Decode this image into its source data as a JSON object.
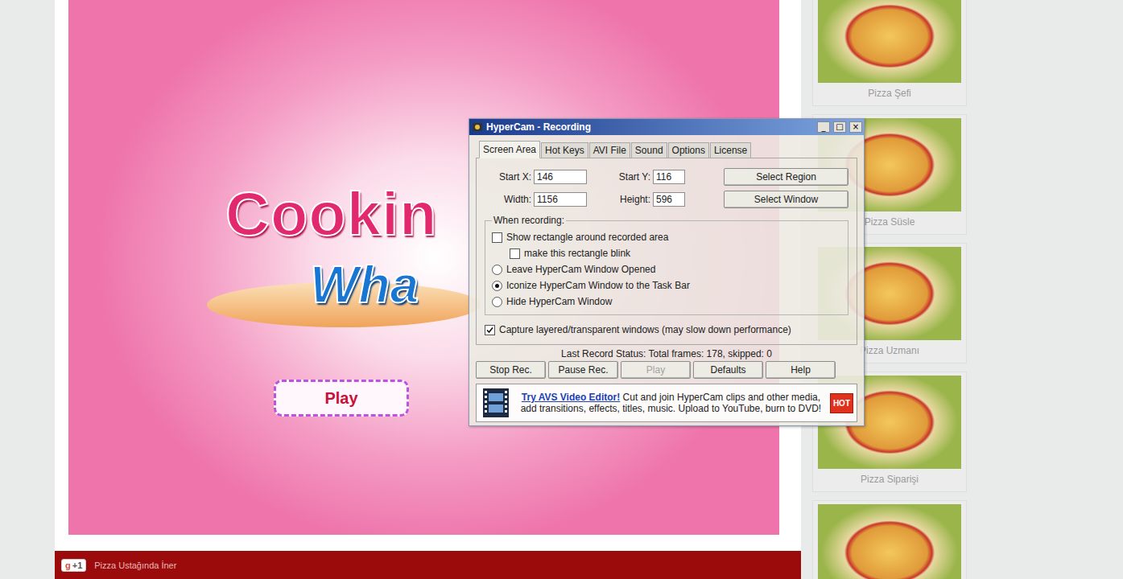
{
  "page": {
    "footer": {
      "plus_one": "+1",
      "text": "Pizza Ustağında İner"
    }
  },
  "game": {
    "logo_top": "Cookin",
    "logo_bottom": "Wha",
    "play": "Play"
  },
  "sidebar": {
    "items": [
      {
        "caption": "Pizza Şefi"
      },
      {
        "caption": "Pizza Süsle"
      },
      {
        "caption": "Pizza Uzmanı"
      },
      {
        "caption": "Pizza Siparişi"
      },
      {}
    ]
  },
  "hypercam": {
    "title": "HyperCam - Recording",
    "title_buttons": [
      "_",
      "□",
      "×"
    ],
    "tabs": [
      {
        "label": "Screen Area",
        "selected": true
      },
      {
        "label": "Hot Keys",
        "selected": false
      },
      {
        "label": "AVI File",
        "selected": false
      },
      {
        "label": "Sound",
        "selected": false
      },
      {
        "label": "Options",
        "selected": false
      },
      {
        "label": "License",
        "selected": false
      }
    ],
    "fields": [
      {
        "label": "Start X:",
        "value": "146"
      },
      {
        "label": "Start Y:",
        "value": "116"
      },
      {
        "label": "Width:",
        "value": "1156"
      },
      {
        "label": "Height:",
        "value": "596"
      }
    ],
    "region_buttons": [
      "Select Region",
      "Select Window"
    ],
    "group_label": "When recording:",
    "options": [
      {
        "kind": "checkbox",
        "label": "Show rectangle around recorded area",
        "checked": false,
        "indent": false
      },
      {
        "kind": "checkbox",
        "label": "make this rectangle blink",
        "checked": false,
        "indent": true
      },
      {
        "kind": "radio",
        "label": "Leave HyperCam Window Opened",
        "selected": false,
        "indent": false
      },
      {
        "kind": "radio",
        "label": "Iconize HyperCam Window to the Task Bar",
        "selected": true,
        "indent": false
      },
      {
        "kind": "radio",
        "label": "Hide HyperCam Window",
        "selected": false,
        "indent": false
      }
    ],
    "capture": {
      "label": "Capture layered/transparent windows (may slow down performance)",
      "checked": true
    },
    "status": "Last Record Status: Total frames: 178, skipped: 0",
    "buttons": [
      {
        "label": "Stop Rec.",
        "disabled": false
      },
      {
        "label": "Pause Rec.",
        "disabled": false
      },
      {
        "label": "Play",
        "disabled": true
      },
      {
        "label": "Defaults",
        "disabled": false
      },
      {
        "label": "Help",
        "disabled": false
      }
    ],
    "ad": {
      "link": "Try AVS Video Editor!",
      "text": " Cut and join HyperCam clips and other media, add transitions, effects, titles, music. Upload to YouTube, burn to DVD!",
      "badge": "HOT"
    }
  }
}
